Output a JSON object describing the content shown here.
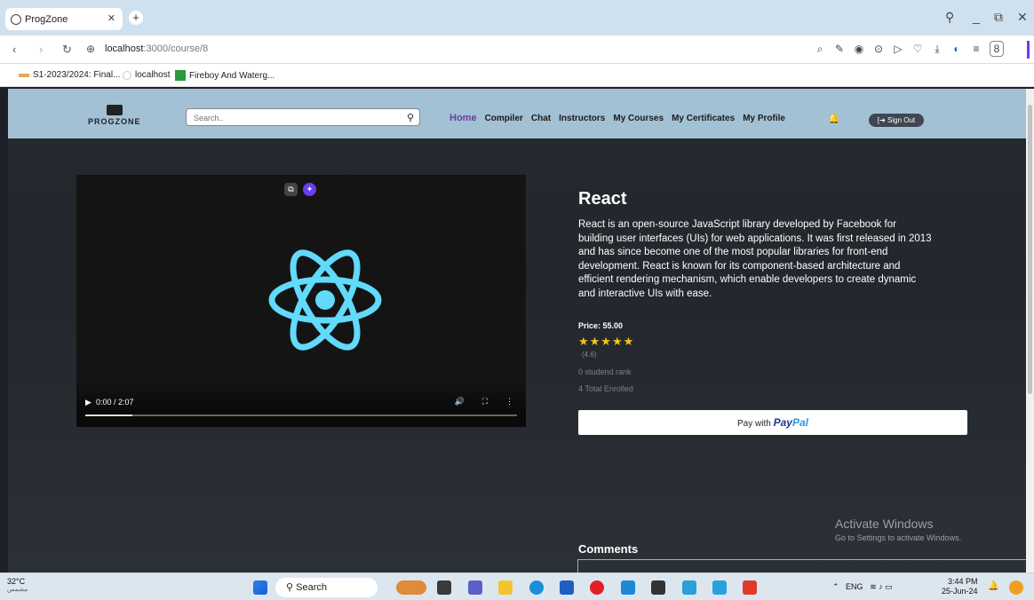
{
  "browser": {
    "tab_title": "ProgZone",
    "new_tab": "+",
    "url_host": "localhost",
    "url_path": ":3000/course/8",
    "bookmarks": [
      "S1-2023/2024: Final...",
      "localhost",
      "Fireboy And Waterg..."
    ]
  },
  "site": {
    "logo_text": "PROGZONE",
    "search_placeholder": "Search..",
    "nav": [
      "Home",
      "Compiler",
      "Chat",
      "Instructors",
      "My Courses",
      "My Certificates",
      "My Profile"
    ],
    "sign_out": "[➜ Sign Out"
  },
  "video": {
    "time": "0:00 / 2:07",
    "progress": 0.11
  },
  "course": {
    "title": "React",
    "description": "React is an open-source JavaScript library developed by Facebook for building user interfaces (UIs) for web applications. It was first released in 2013 and has since become one of the most popular libraries for front-end development. React is known for its component-based architecture and efficient rendering mechanism, which enable developers to create dynamic and interactive UIs with ease.",
    "price": "Price: 55.00",
    "stars": "★★★★★",
    "rating": "(4.6)",
    "rank": "0 studend rank",
    "enrolled": "4 Total Enrolled",
    "pay_prefix": "Pay with",
    "pay_brand_a": "Pay",
    "pay_brand_b": "Pal",
    "comments_heading": "Comments"
  },
  "watermark": {
    "line1": "Activate Windows",
    "line2": "Go to Settings to activate Windows."
  },
  "taskbar": {
    "temp": "32°C",
    "weather": "مشمس",
    "search": "Search",
    "lang": "ENG",
    "time": "3:44 PM",
    "date": "25-Jun-24"
  },
  "colors": {
    "header_bg": "#a3c1d4",
    "home_active": "#6c3aa0",
    "react_logo": "#61dafb",
    "star": "#f3c41a",
    "paypal_blue": "#153a8f"
  }
}
